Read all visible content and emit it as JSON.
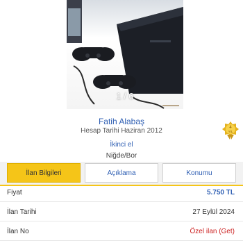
{
  "photo": {
    "counter": "1 / 6"
  },
  "seller": {
    "name": "Fatih Alabaş",
    "since": "Hesap Tarihi  Haziran 2012",
    "badge_years": "4",
    "badge_unit": "YIL",
    "badge_icon": "medal-icon"
  },
  "listing": {
    "condition": "İkinci el",
    "location": "Niğde/Bor"
  },
  "tabs": [
    {
      "label": "İlan Bilgileri",
      "active": true
    },
    {
      "label": "Açıklama",
      "active": false
    },
    {
      "label": "Konumu",
      "active": false
    }
  ],
  "details": [
    {
      "label": "Fiyat",
      "value": "5.750 TL"
    },
    {
      "label": "İlan Tarihi",
      "value": "27 Eylül 2024"
    },
    {
      "label": "İlan No",
      "value": "Özel ilan (Get)"
    }
  ],
  "colors": {
    "accent": "#f5c518",
    "link": "#2f5fb3",
    "red": "#cc2222"
  }
}
